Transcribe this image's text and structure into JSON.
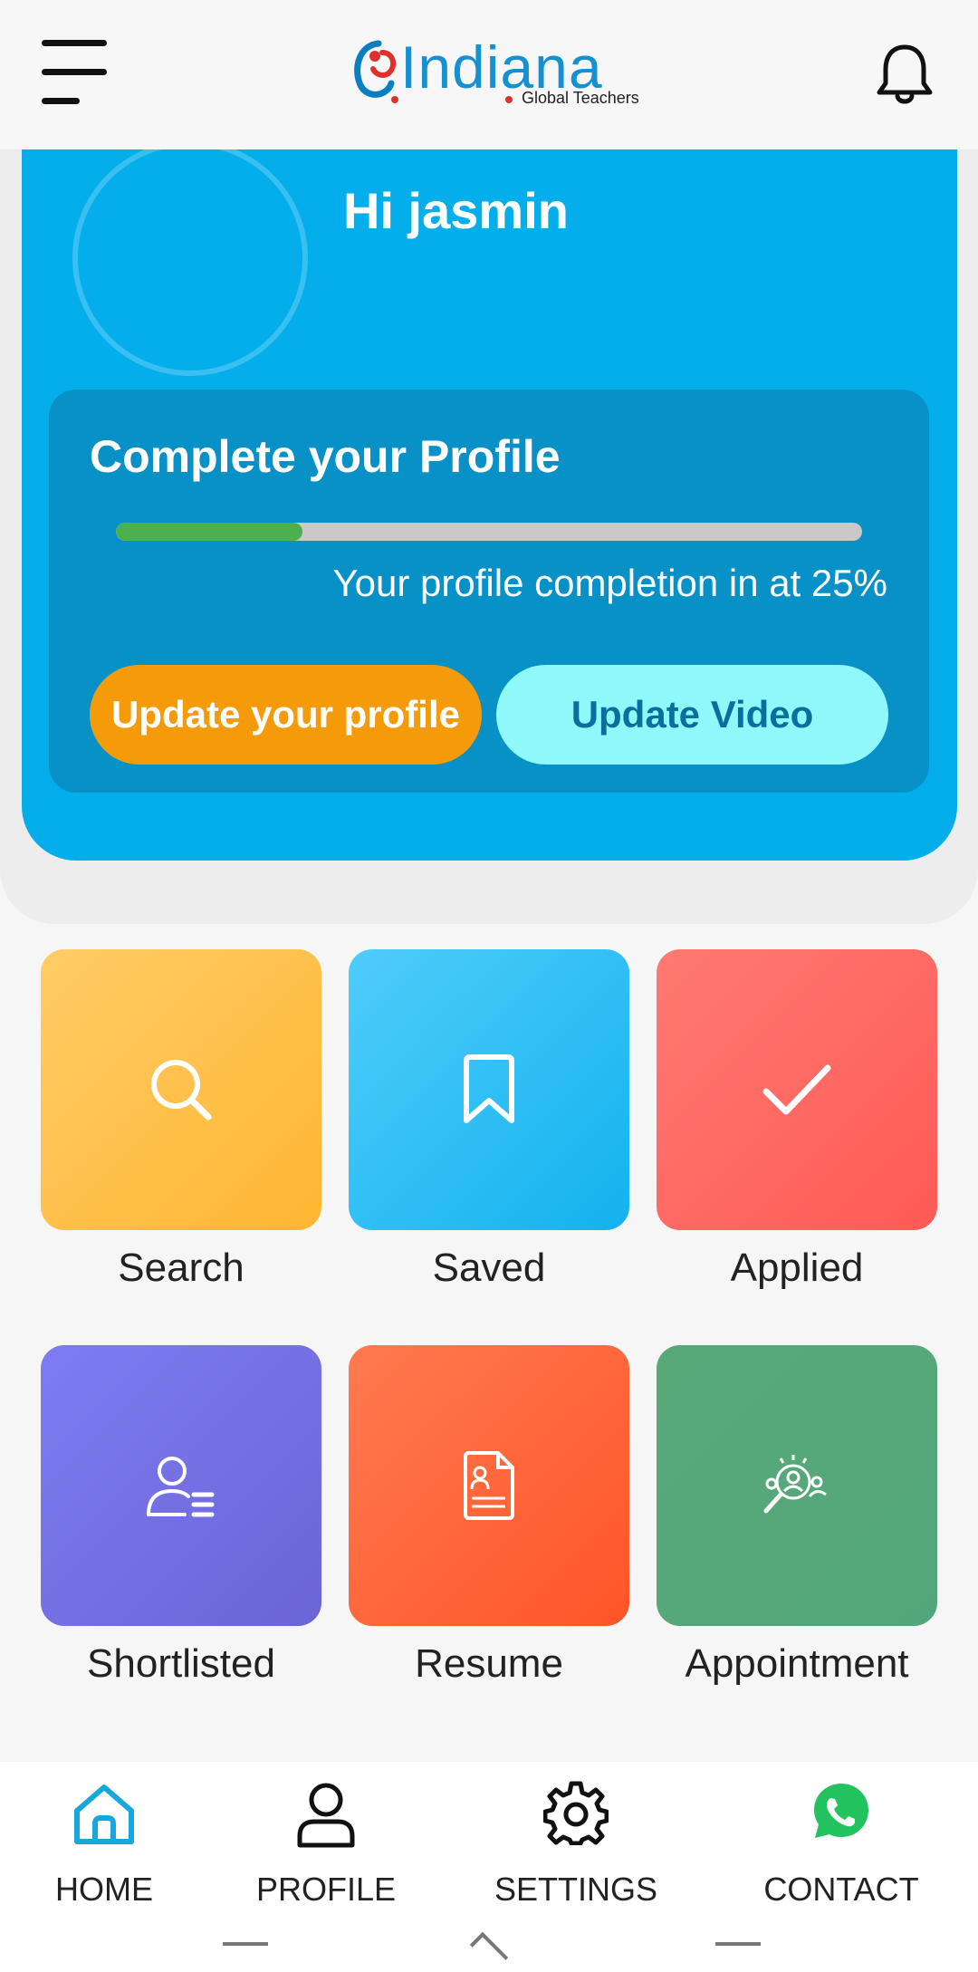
{
  "app": {
    "logo_text": "Indiana",
    "logo_subtext": "Global Teachers"
  },
  "header": {
    "greeting": "Hi jasmin"
  },
  "profile_card": {
    "title": "Complete your Profile",
    "completion_fraction": 0.25,
    "completion_text": "Your profile completion in at 25%",
    "update_profile_label": "Update your profile",
    "update_video_label": "Update Video"
  },
  "tiles": [
    {
      "label": "Search",
      "icon": "search-icon",
      "color_start": "#ffcc66",
      "color_end": "#ffb632"
    },
    {
      "label": "Saved",
      "icon": "bookmark-icon",
      "color_start": "#4fcdfb",
      "color_end": "#13b2ee"
    },
    {
      "label": "Applied",
      "icon": "check-icon",
      "color_start": "#ff7a72",
      "color_end": "#ff5a56"
    },
    {
      "label": "Shortlisted",
      "icon": "user-list-icon",
      "color_start": "#7f7cf2",
      "color_end": "#6a64d6"
    },
    {
      "label": "Resume",
      "icon": "document-icon",
      "color_start": "#ff7a50",
      "color_end": "#ff5528"
    },
    {
      "label": "Appointment",
      "icon": "search-people-icon",
      "color_start": "#58a87a",
      "color_end": "#53a67b"
    }
  ],
  "bottom_nav": [
    {
      "label": "HOME",
      "icon": "home-icon",
      "active": true
    },
    {
      "label": "PROFILE",
      "icon": "person-icon",
      "active": false
    },
    {
      "label": "SETTINGS",
      "icon": "gear-icon",
      "active": false
    },
    {
      "label": "CONTACT",
      "icon": "whatsapp-icon",
      "active": false
    }
  ],
  "colors": {
    "brand_blue": "#03aeeb",
    "profile_box": "#0891c6",
    "accent_orange": "#f59b0a",
    "accent_cyan": "#8ef8fb",
    "progress_green": "#4caf50",
    "nav_active": "#18a7dd"
  }
}
